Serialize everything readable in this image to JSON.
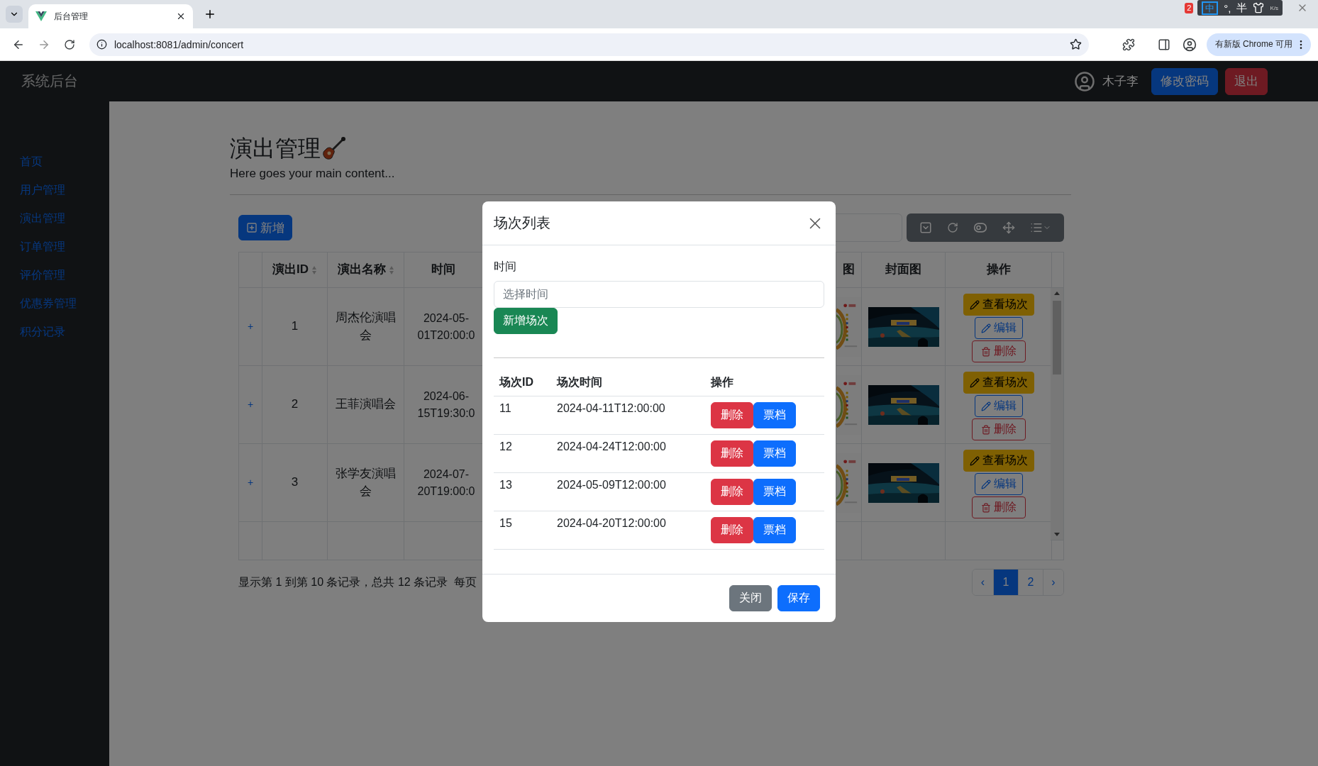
{
  "browser": {
    "tab_title": "后台管理",
    "url": "localhost:8081/admin/concert",
    "update_pill": "有新版 Chrome 可用",
    "notification_count": "2",
    "ime": [
      "中",
      "°,",
      "半"
    ],
    "net_speed": "K/s"
  },
  "header": {
    "brand": "系统后台",
    "user": "木子李",
    "buttons": [
      {
        "label": "修改密码",
        "kind": "primary"
      },
      {
        "label": "退出",
        "kind": "danger"
      }
    ]
  },
  "sidebar": {
    "items": [
      "首页",
      "用户管理",
      "演出管理",
      "订单管理",
      "评价管理",
      "优惠券管理",
      "积分记录"
    ]
  },
  "page": {
    "title": "演出管理",
    "subtitle": "Here goes your main content...",
    "add_button": "新增"
  },
  "table": {
    "columns": [
      {
        "label": "演出ID",
        "sortable": true
      },
      {
        "label": "演出名称",
        "sortable": true
      },
      {
        "label": "时间",
        "sortable": false
      },
      {
        "label": "图",
        "sortable": false
      },
      {
        "label": "封面图",
        "sortable": false
      },
      {
        "label": "操作",
        "sortable": false
      }
    ],
    "rows": [
      {
        "expander": "+",
        "id": "1",
        "name": "周杰伦演唱会",
        "time": "2024-05-\n01T20:00:0",
        "actions": [
          {
            "label": "查看场次",
            "kind": "view"
          },
          {
            "label": "编辑",
            "kind": "edit"
          },
          {
            "label": "删除",
            "kind": "delete"
          }
        ]
      },
      {
        "expander": "+",
        "id": "2",
        "name": "王菲演唱会",
        "time": "2024-06-\n15T19:30:0",
        "actions": [
          {
            "label": "查看场次",
            "kind": "view"
          },
          {
            "label": "编辑",
            "kind": "edit"
          },
          {
            "label": "删除",
            "kind": "delete"
          }
        ]
      },
      {
        "expander": "+",
        "id": "3",
        "name": "张学友演唱会",
        "time": "2024-07-\n20T19:00:0",
        "actions": [
          {
            "label": "查看场次",
            "kind": "view"
          },
          {
            "label": "编辑",
            "kind": "edit"
          },
          {
            "label": "删除",
            "kind": "delete"
          }
        ]
      }
    ]
  },
  "table_info": "显示第 1 到第 10 条记录，总共 12 条记录  每页",
  "pagination": [
    {
      "label": "‹",
      "selected": false
    },
    {
      "label": "1",
      "selected": true
    },
    {
      "label": "2",
      "selected": false
    },
    {
      "label": "›",
      "selected": false
    }
  ],
  "modal": {
    "title": "场次列表",
    "field_label": "时间",
    "placeholder": "选择时间",
    "add_button": "新增场次",
    "columns": [
      "场次ID",
      "场次时间",
      "操作"
    ],
    "rows": [
      {
        "id": "11",
        "time": "2024-04-11T12:00:00",
        "actions": [
          {
            "label": "删除",
            "kind": "danger"
          },
          {
            "label": "票档",
            "kind": "primary"
          }
        ]
      },
      {
        "id": "12",
        "time": "2024-04-24T12:00:00",
        "actions": [
          {
            "label": "删除",
            "kind": "danger"
          },
          {
            "label": "票档",
            "kind": "primary"
          }
        ]
      },
      {
        "id": "13",
        "time": "2024-05-09T12:00:00",
        "actions": [
          {
            "label": "删除",
            "kind": "danger"
          },
          {
            "label": "票档",
            "kind": "primary"
          }
        ]
      },
      {
        "id": "15",
        "time": "2024-04-20T12:00:00",
        "actions": [
          {
            "label": "删除",
            "kind": "danger"
          },
          {
            "label": "票档",
            "kind": "primary"
          }
        ]
      }
    ],
    "footer_buttons": [
      {
        "label": "关闭",
        "kind": "secondary"
      },
      {
        "label": "保存",
        "kind": "primary"
      }
    ]
  }
}
